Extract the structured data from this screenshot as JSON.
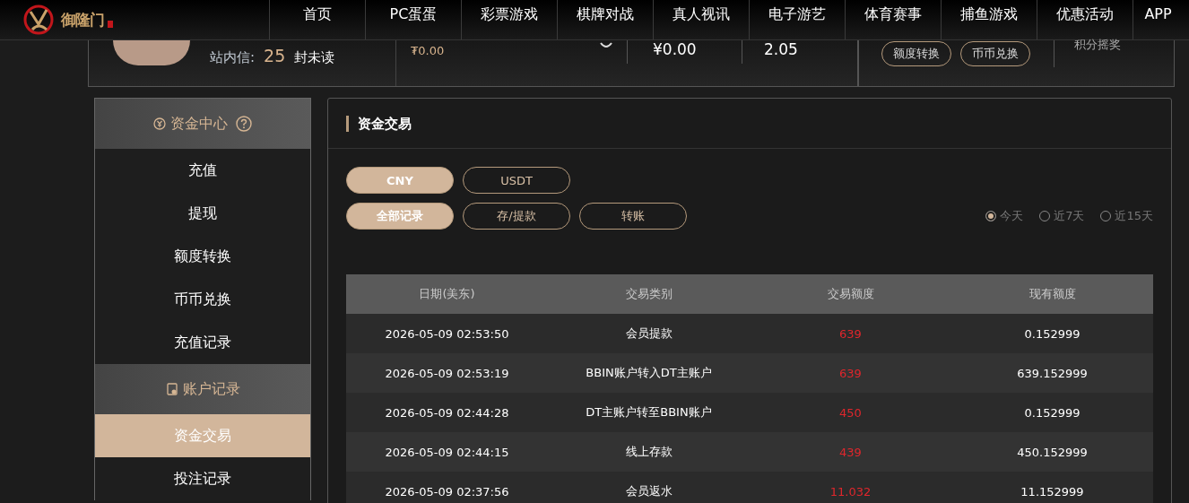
{
  "header": {
    "logo_text": "御隆门",
    "nav": [
      {
        "label": "首页"
      },
      {
        "label": "PC蛋蛋"
      },
      {
        "label": "彩票游戏"
      },
      {
        "label": "棋牌对战"
      },
      {
        "label": "真人视讯"
      },
      {
        "label": "电子游艺"
      },
      {
        "label": "体育赛事"
      },
      {
        "label": "捕鱼游戏"
      },
      {
        "label": "优惠活动"
      },
      {
        "label": "APP"
      }
    ]
  },
  "account": {
    "messages_label": "站内信:",
    "unread_count": "25",
    "unread_suffix": "封未读",
    "usdt_balance": "₮0.00",
    "cny_balance": "¥0.00",
    "value_3": "2.05",
    "buttons": [
      "额度转换",
      "币币兑换"
    ],
    "points_lottery": "积分摇奖"
  },
  "sidebar": {
    "sections": [
      {
        "title": "资金中心",
        "help": true,
        "items": [
          {
            "label": "充值",
            "selected": false
          },
          {
            "label": "提现",
            "selected": false
          },
          {
            "label": "额度转换",
            "selected": false
          },
          {
            "label": "币币兑换",
            "selected": false
          },
          {
            "label": "充值记录",
            "selected": false
          }
        ]
      },
      {
        "title": "账户记录",
        "help": false,
        "items": [
          {
            "label": "资金交易",
            "selected": true
          },
          {
            "label": "投注记录",
            "selected": false
          }
        ]
      }
    ]
  },
  "panel": {
    "title": "资金交易",
    "currency_tabs": [
      {
        "label": "CNY",
        "selected": true
      },
      {
        "label": "USDT",
        "selected": false
      }
    ],
    "type_tabs": [
      {
        "label": "全部记录",
        "selected": true
      },
      {
        "label": "存/提款",
        "selected": false
      },
      {
        "label": "转账",
        "selected": false
      }
    ],
    "date_range": [
      {
        "label": "今天",
        "selected": true
      },
      {
        "label": "近7天",
        "selected": false
      },
      {
        "label": "近15天",
        "selected": false
      }
    ],
    "table": {
      "columns": [
        "日期(美东)",
        "交易类别",
        "交易额度",
        "现有额度"
      ],
      "rows": [
        [
          "2026-05-09 02:53:50",
          "会员提款",
          "639",
          "0.152999"
        ],
        [
          "2026-05-09 02:53:19",
          "BBIN账户转入DT主账户",
          "639",
          "639.152999"
        ],
        [
          "2026-05-09 02:44:28",
          "DT主账户转至BBIN账户",
          "450",
          "0.152999"
        ],
        [
          "2026-05-09 02:44:15",
          "线上存款",
          "439",
          "450.152999"
        ],
        [
          "2026-05-09 02:37:56",
          "会员返水",
          "11.032",
          "11.152999"
        ]
      ]
    }
  }
}
